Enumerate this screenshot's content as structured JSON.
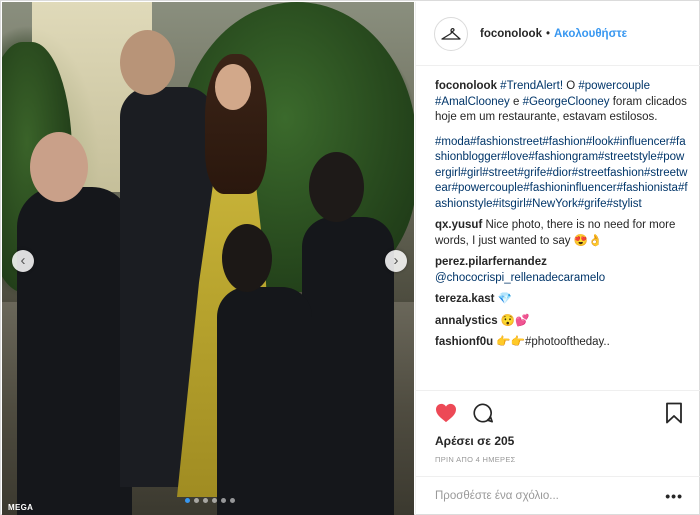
{
  "post": {
    "username": "foconolook",
    "follow_label": "Ακολουθήστε",
    "separator": "•",
    "photo_credit": "MEGA",
    "carousel": {
      "count": 6,
      "active_index": 0
    }
  },
  "caption": {
    "username": "foconolook",
    "segments": [
      {
        "text": "#TrendAlert!",
        "tag": true
      },
      {
        "text": " O ",
        "tag": false
      },
      {
        "text": "#powercouple",
        "tag": true
      },
      {
        "text": " ",
        "tag": false
      },
      {
        "text": "#AmalClooney",
        "tag": true
      },
      {
        "text": " e ",
        "tag": false
      },
      {
        "text": "#GeorgeClooney",
        "tag": true
      },
      {
        "text": " foram clicados hoje em um restaurante, estavam estilosos.",
        "tag": false
      }
    ]
  },
  "hashtags": "#moda#fashionstreet#fashion#look#influencer#fashionblogger#love#fashiongram#streetstyle#powergirl#girl#street#grife#dior#streetfashion#streetwear#powercouple#fashioninfluencer#fashionista#fashionstyle#itsgirl#NewYork#grife#stylist",
  "comments": [
    {
      "user": "qx.yusuf",
      "text": "Nice photo, there is no need for more words, I just wanted to say 😍👌",
      "tag": false
    },
    {
      "user": "perez.pilarfernandez",
      "text": "@chococrispi_rellenadecaramelo",
      "tag": true
    },
    {
      "user": "tereza.kast",
      "text": "💎",
      "tag": false
    },
    {
      "user": "annalystics",
      "text": "😯💕",
      "tag": false
    },
    {
      "user": "fashionf0u",
      "text": "👉👉#photooftheday..",
      "tag": false
    }
  ],
  "actions": {
    "likes_text": "Αρέσει σε 205",
    "time_text": "ΠΡΙΝ ΑΠΟ 4 ΗΜΕΡΕΣ",
    "like_color": "#ed4956"
  },
  "add_comment": {
    "placeholder": "Προσθέστε ένα σχόλιο...",
    "more_label": "•••"
  }
}
